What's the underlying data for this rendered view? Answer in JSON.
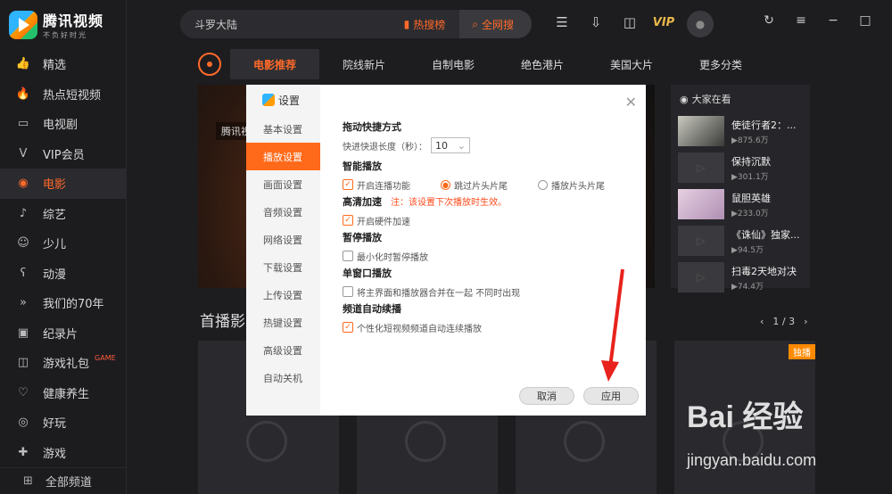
{
  "app": {
    "title": "腾讯视频",
    "slogan": "不负好时光"
  },
  "search": {
    "query": "斗罗大陆",
    "hot_label": "热搜榜",
    "whole_label": "全网搜"
  },
  "toolbar": {
    "vip": "VIP"
  },
  "sidebar": {
    "items": [
      {
        "label": "精选",
        "icon": "thumbs-up-icon",
        "glyph": "👍"
      },
      {
        "label": "热点短视频",
        "icon": "fire-icon",
        "glyph": "🔥"
      },
      {
        "label": "电视剧",
        "icon": "tv-icon",
        "glyph": "▭"
      },
      {
        "label": "VIP会员",
        "icon": "vip-icon",
        "glyph": "V"
      },
      {
        "label": "电影",
        "icon": "film-reel-icon",
        "glyph": "◉"
      },
      {
        "label": "综艺",
        "icon": "mic-icon",
        "glyph": "♪"
      },
      {
        "label": "少儿",
        "icon": "kid-icon",
        "glyph": "☺"
      },
      {
        "label": "动漫",
        "icon": "bear-icon",
        "glyph": "ʕ"
      },
      {
        "label": "我们的70年",
        "icon": "chevrons-icon",
        "glyph": "»"
      },
      {
        "label": "纪录片",
        "icon": "camera-icon",
        "glyph": "▣"
      },
      {
        "label": "游戏礼包",
        "icon": "gamepad-icon",
        "glyph": "◫",
        "badge": "GAME"
      },
      {
        "label": "健康养生",
        "icon": "heart-icon",
        "glyph": "♡"
      },
      {
        "label": "好玩",
        "icon": "smile-icon",
        "glyph": "◎"
      },
      {
        "label": "游戏",
        "icon": "controller-icon",
        "glyph": "✚"
      }
    ],
    "all_channels": "全部频道"
  },
  "tabs": [
    "电影推荐",
    "院线新片",
    "自制电影",
    "绝色港片",
    "美国大片",
    "更多分类"
  ],
  "banner": {
    "logo": "腾讯视"
  },
  "ranking": {
    "title": "大家在看",
    "items": [
      {
        "title": "使徒行者2：...",
        "count": "▶875.6万"
      },
      {
        "title": "保持沉默",
        "count": "▶301.1万"
      },
      {
        "title": "鼠胆英雄",
        "count": "▶233.0万"
      },
      {
        "title": "《诛仙》独家...",
        "count": "▶94.5万"
      },
      {
        "title": "扫毒2天地对决",
        "count": "▶74.4万"
      }
    ]
  },
  "section": {
    "title": "首播影",
    "pager": "1 / 3",
    "badge": "独播"
  },
  "dialog": {
    "title": "设置",
    "nav": [
      "基本设置",
      "播放设置",
      "画面设置",
      "音频设置",
      "网络设置",
      "下载设置",
      "上传设置",
      "热键设置",
      "高级设置",
      "自动关机"
    ],
    "sections": {
      "shortcut_heading": "拖动快捷方式",
      "ff_label": "快进快退长度（秒）：",
      "ff_value": "10",
      "smart_heading": "智能播放",
      "opt_continuous": "开启连播功能",
      "opt_skip": "跳过片头片尾",
      "opt_play": "播放片头片尾",
      "hd_heading": "高清加速",
      "hd_note": "注：该设置下次播放时生效。",
      "opt_hw": "开启硬件加速",
      "pause_heading": "暂停播放",
      "opt_minpause": "最小化时暂停播放",
      "single_heading": "单窗口播放",
      "opt_merge": "将主界面和播放器合并在一起 不同时出现",
      "channel_heading": "频道自动续播",
      "opt_personal": "个性化短视频频道自动连续播放"
    },
    "cancel": "取消",
    "apply": "应用"
  },
  "watermark": {
    "brand": "Bai 经验",
    "url": "jingyan.baidu.com"
  }
}
